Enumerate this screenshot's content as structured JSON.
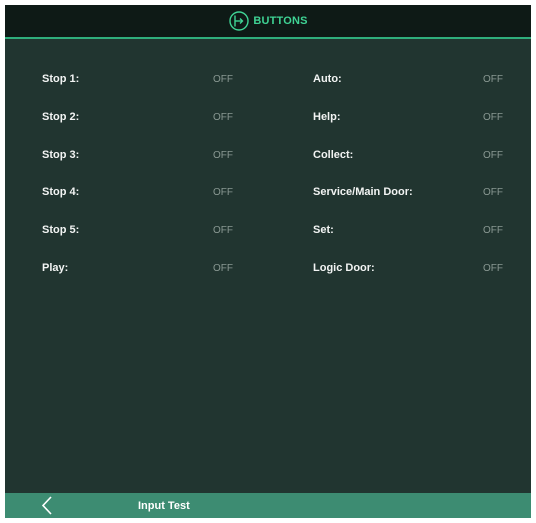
{
  "header": {
    "title": "BUTTONS",
    "icon": "buttons-icon",
    "accent_color": "#3fd394"
  },
  "buttons_left": [
    {
      "label": "Stop 1:",
      "state": "OFF"
    },
    {
      "label": "Stop 2:",
      "state": "OFF"
    },
    {
      "label": "Stop 3:",
      "state": "OFF"
    },
    {
      "label": "Stop 4:",
      "state": "OFF"
    },
    {
      "label": "Stop 5:",
      "state": "OFF"
    },
    {
      "label": "Play:",
      "state": "OFF"
    }
  ],
  "buttons_right": [
    {
      "label": "Auto:",
      "state": "OFF"
    },
    {
      "label": "Help:",
      "state": "OFF"
    },
    {
      "label": "Collect:",
      "state": "OFF"
    },
    {
      "label": "Service/Main Door:",
      "state": "OFF"
    },
    {
      "label": "Set:",
      "state": "OFF"
    },
    {
      "label": "Logic Door:",
      "state": "OFF"
    }
  ],
  "footer": {
    "back_icon": "chevron-left-icon",
    "label": "Input Test"
  },
  "colors": {
    "background": "#213530",
    "header_background": "#0e1a16",
    "footer_background": "#3d8c72",
    "label_text": "#f2f4f3",
    "state_text": "#8a9993"
  }
}
